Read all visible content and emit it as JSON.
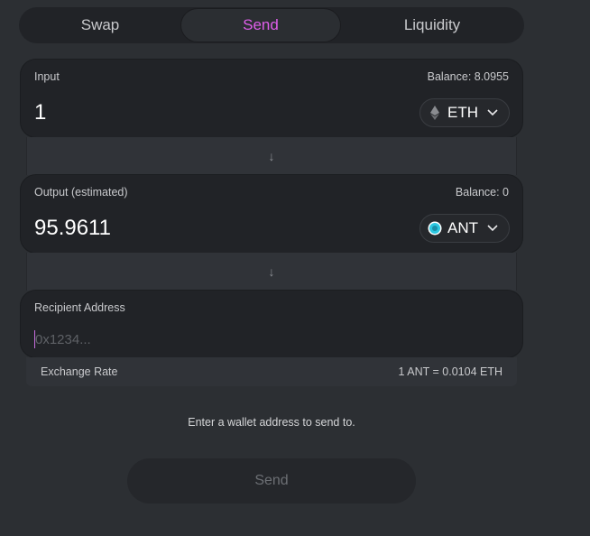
{
  "tabs": [
    {
      "label": "Swap"
    },
    {
      "label": "Send"
    },
    {
      "label": "Liquidity"
    }
  ],
  "active_tab": "Send",
  "accent_color": "#de5ee9",
  "input": {
    "label": "Input",
    "balance": "Balance: 8.0955",
    "amount": "1",
    "token": "ETH",
    "token_icon": "ethereum-icon"
  },
  "output": {
    "label": "Output (estimated)",
    "balance": "Balance: 0",
    "amount": "95.9611",
    "token": "ANT",
    "token_icon": "ant-token-icon"
  },
  "recipient": {
    "label": "Recipient Address",
    "placeholder": "0x1234..."
  },
  "exchange_rate": {
    "label": "Exchange Rate",
    "value": "1 ANT = 0.0104 ETH"
  },
  "hint": "Enter a wallet address to send to.",
  "send_button": "Send"
}
